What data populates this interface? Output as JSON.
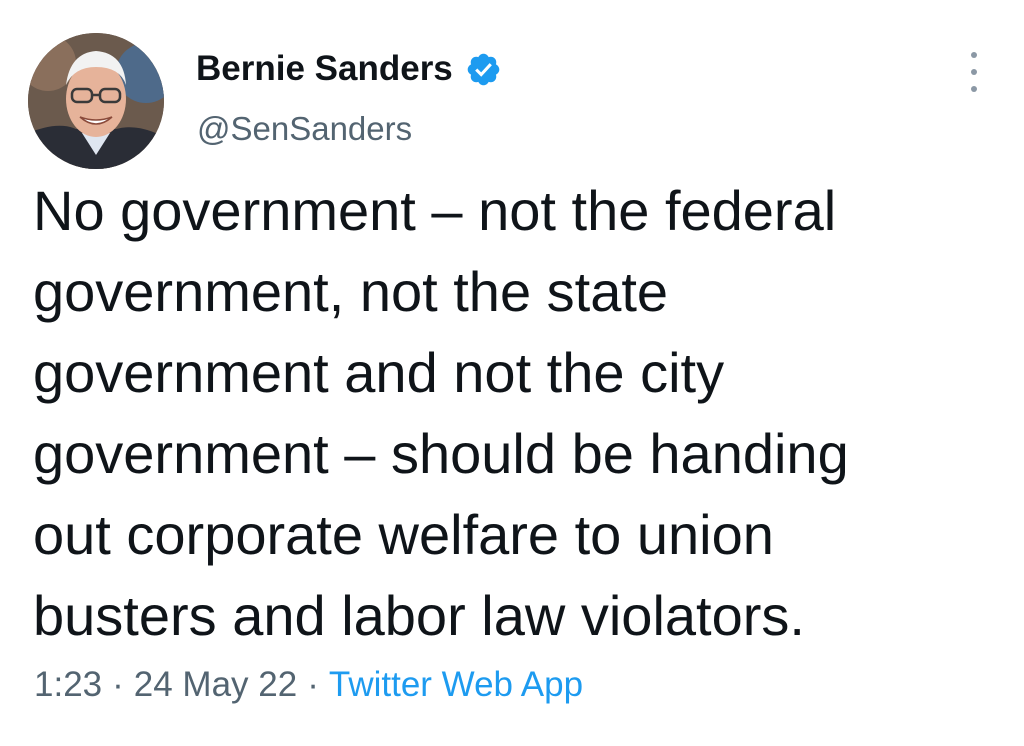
{
  "user": {
    "display_name": "Bernie Sanders",
    "handle": "@SenSanders",
    "verified_icon": "verified-badge-icon"
  },
  "tweet": {
    "text_lines": [
      "No government – not the federal",
      "government, not the state",
      "government and not the city",
      "government – should be handing",
      "out corporate welfare to union",
      "busters and labor law violators."
    ]
  },
  "meta": {
    "time": "1:23",
    "separator": "·",
    "date": "24 May 22",
    "source": "Twitter Web App"
  },
  "colors": {
    "text": "#0f1419",
    "secondary": "#536471",
    "link": "#1d9bf0",
    "verified": "#1d9bf0"
  }
}
